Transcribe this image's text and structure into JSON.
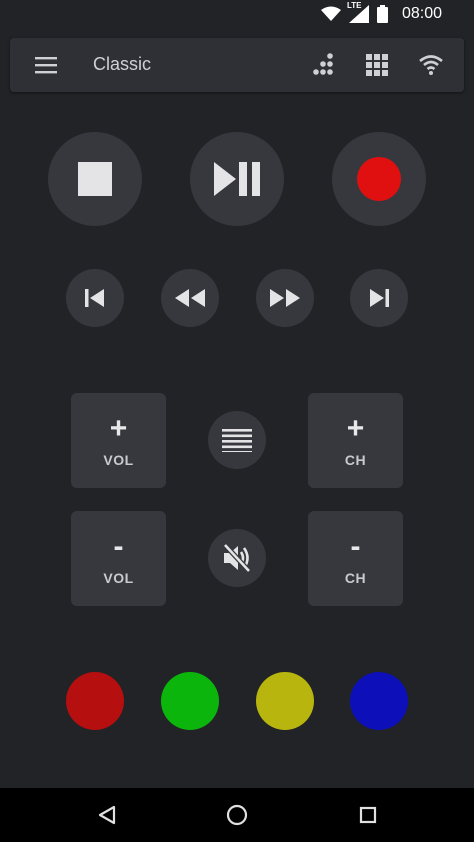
{
  "status_bar": {
    "network_label": "LTE",
    "time": "08:00",
    "icons": [
      "wifi-icon",
      "signal-icon",
      "battery-icon"
    ]
  },
  "toolbar": {
    "title": "Classic",
    "icons": [
      "menu-icon",
      "numpad-dots-icon",
      "grid-icon",
      "wifi-icon"
    ]
  },
  "playback": {
    "buttons": [
      "stop",
      "play-pause",
      "record"
    ],
    "record_color": "#e01010"
  },
  "transport": {
    "buttons": [
      "skip-previous",
      "rewind",
      "fast-forward",
      "skip-next"
    ]
  },
  "volume": {
    "up_symbol": "+",
    "up_label": "VOL",
    "down_symbol": "-",
    "down_label": "VOL"
  },
  "channel": {
    "up_symbol": "+",
    "up_label": "CH",
    "down_symbol": "-",
    "down_label": "CH"
  },
  "center": {
    "buttons": [
      "menu-lines",
      "mute"
    ]
  },
  "color_buttons": [
    {
      "name": "red",
      "color": "#b50f10"
    },
    {
      "name": "green",
      "color": "#0bb50b"
    },
    {
      "name": "yellow",
      "color": "#b8b50f"
    },
    {
      "name": "blue",
      "color": "#0d0fb8"
    }
  ],
  "nav_bar": {
    "buttons": [
      "back",
      "home",
      "recents"
    ]
  }
}
